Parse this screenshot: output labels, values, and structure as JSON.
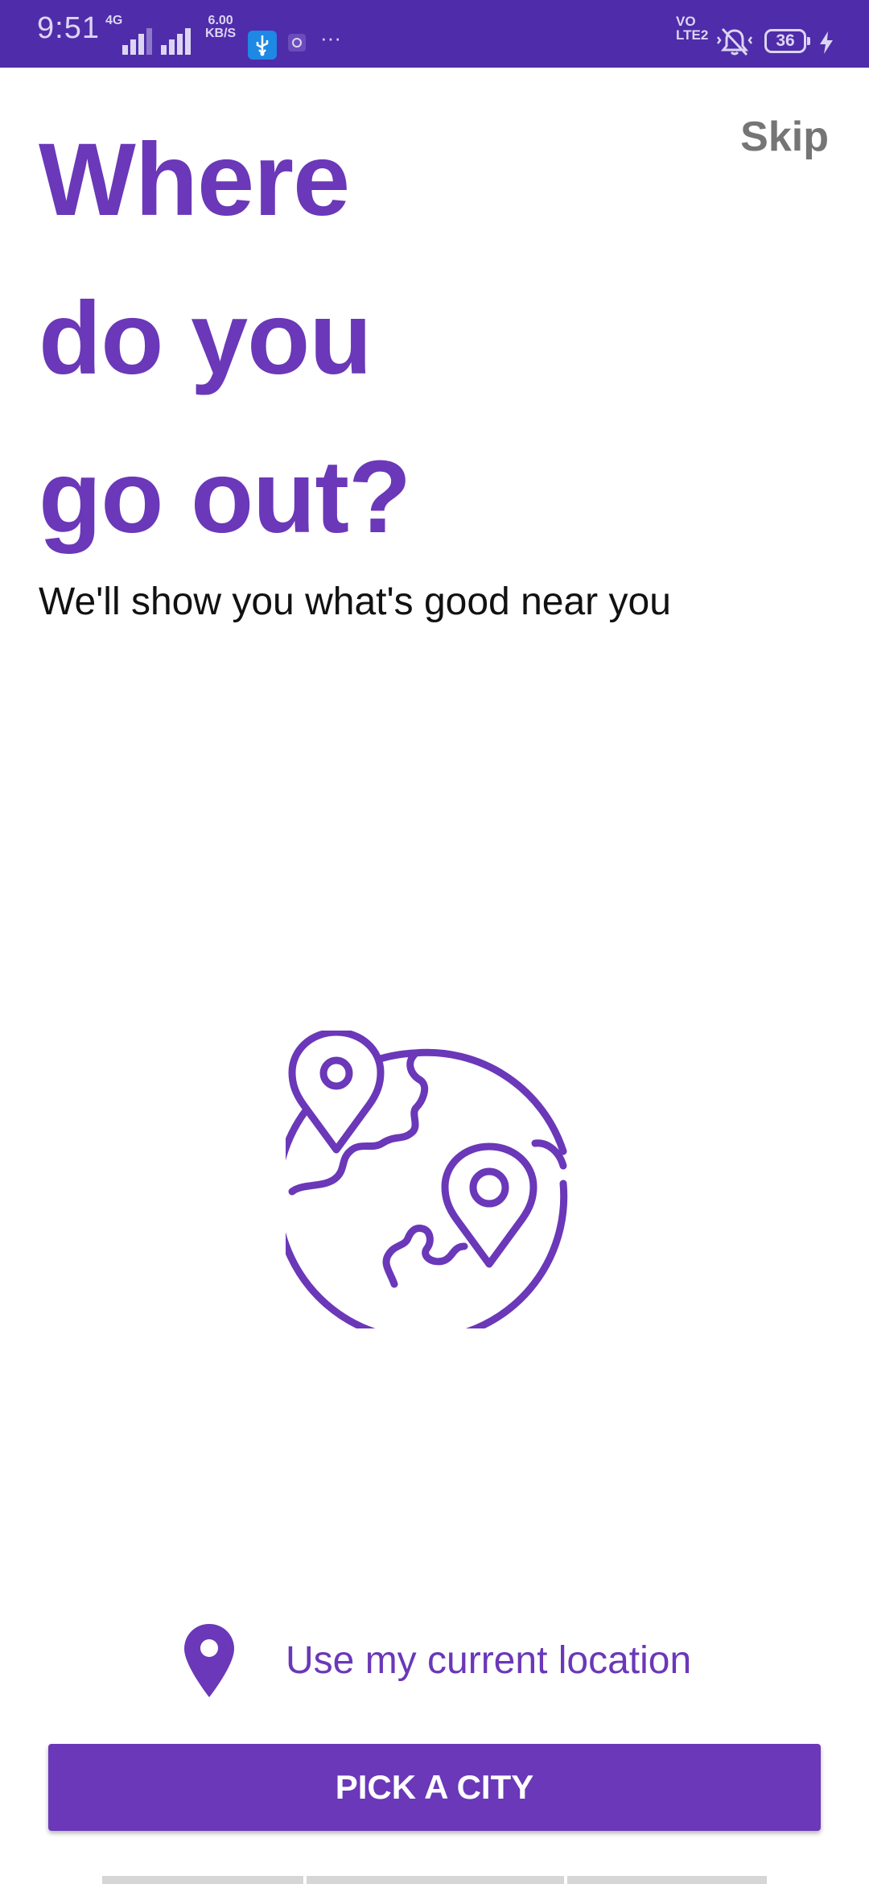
{
  "status_bar": {
    "time": "9:51",
    "network_type": "4G",
    "data_speed_value": "6.00",
    "data_speed_unit": "KB/S",
    "volte": "VO",
    "volte_sub": "LTE2",
    "battery": "36",
    "overflow": "···"
  },
  "header": {
    "skip_label": "Skip",
    "title_line1": "Where",
    "title_line2": "do you",
    "title_line3": "go out?",
    "subtitle": "We'll show you what's good near you"
  },
  "illustration": {
    "icon": "globe-with-location-pins-icon"
  },
  "actions": {
    "current_location_label": "Use my current location",
    "pick_city_label": "PICK A CITY"
  },
  "colors": {
    "accent": "#6a38b8",
    "status_bar": "#4f2ca9",
    "skip_text": "#757575"
  }
}
